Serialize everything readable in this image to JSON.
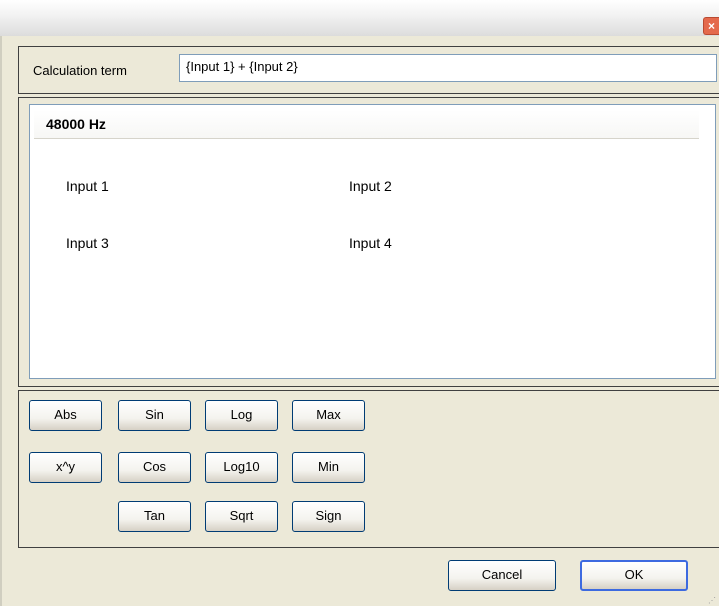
{
  "window": {
    "close_label": "×"
  },
  "calc": {
    "label": "Calculation term",
    "value": "{Input 1} + {Input 2}"
  },
  "inputs": {
    "header": "48000 Hz",
    "items": [
      "Input 1",
      "Input 2",
      "Input 3",
      "Input 4"
    ]
  },
  "functions": {
    "row1": [
      "Abs",
      "Sin",
      "Log",
      "Max"
    ],
    "row2": [
      "x^y",
      "Cos",
      "Log10",
      "Min"
    ],
    "row3": [
      "Tan",
      "Sqrt",
      "Sign"
    ]
  },
  "footer": {
    "cancel_label": "Cancel",
    "ok_label": "OK"
  },
  "colors": {
    "dialog_bg": "#ece9d8",
    "button_border": "#003c74",
    "close_red": "#e4694c"
  }
}
